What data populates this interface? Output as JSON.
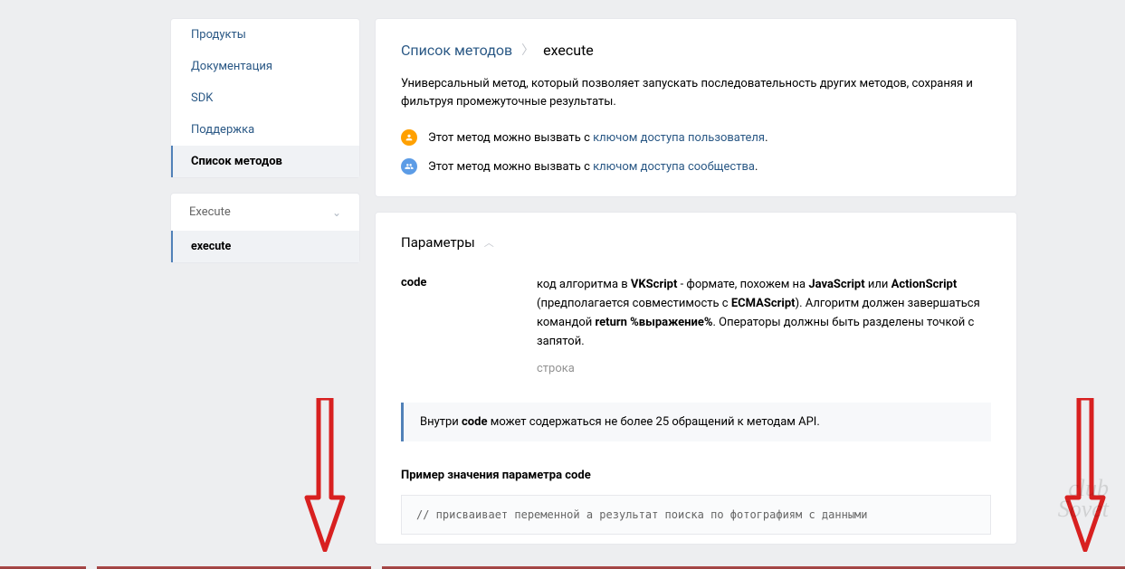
{
  "sidebar": {
    "nav": [
      {
        "label": "Продукты"
      },
      {
        "label": "Документация"
      },
      {
        "label": "SDK"
      },
      {
        "label": "Поддержка"
      },
      {
        "label": "Список методов"
      }
    ],
    "dropdown": {
      "title": "Execute",
      "item": "execute"
    }
  },
  "breadcrumb": {
    "root": "Список методов",
    "sep": "〉",
    "current": "execute"
  },
  "description": "Универсальный метод, который позволяет запускать последовательность других методов, сохраняя и фильтруя промежуточные результаты.",
  "access": {
    "prefix": "Этот метод можно вызвать с ",
    "user_link": "ключом доступа пользователя",
    "group_link": "ключом доступа сообщества",
    "dot": "."
  },
  "params": {
    "title": "Параметры",
    "code": {
      "name": "code",
      "desc_1": "код алгоритма в ",
      "b1": "VKScript",
      "desc_2": " - формате, похожем на ",
      "b2": "JavaScript",
      "desc_3": " или ",
      "b3": "ActionScript",
      "desc_4": " (предполагается совместимость с ",
      "b4": "ECMAScript",
      "desc_5": "). Алгоритм должен завершаться командой ",
      "b5": "return %выражение%",
      "desc_6": ". Операторы должны быть разделены точкой с запятой.",
      "type": "строка"
    }
  },
  "note": {
    "pre": "Внутри ",
    "b": "code",
    "post": " может содержаться не более 25 обращений к методам API."
  },
  "example": {
    "title": "Пример значения параметра code",
    "code": "// присваивает переменной a результат поиска по фотографиям с данными"
  },
  "watermark": {
    "l1": "club",
    "l2": "Sovet"
  }
}
